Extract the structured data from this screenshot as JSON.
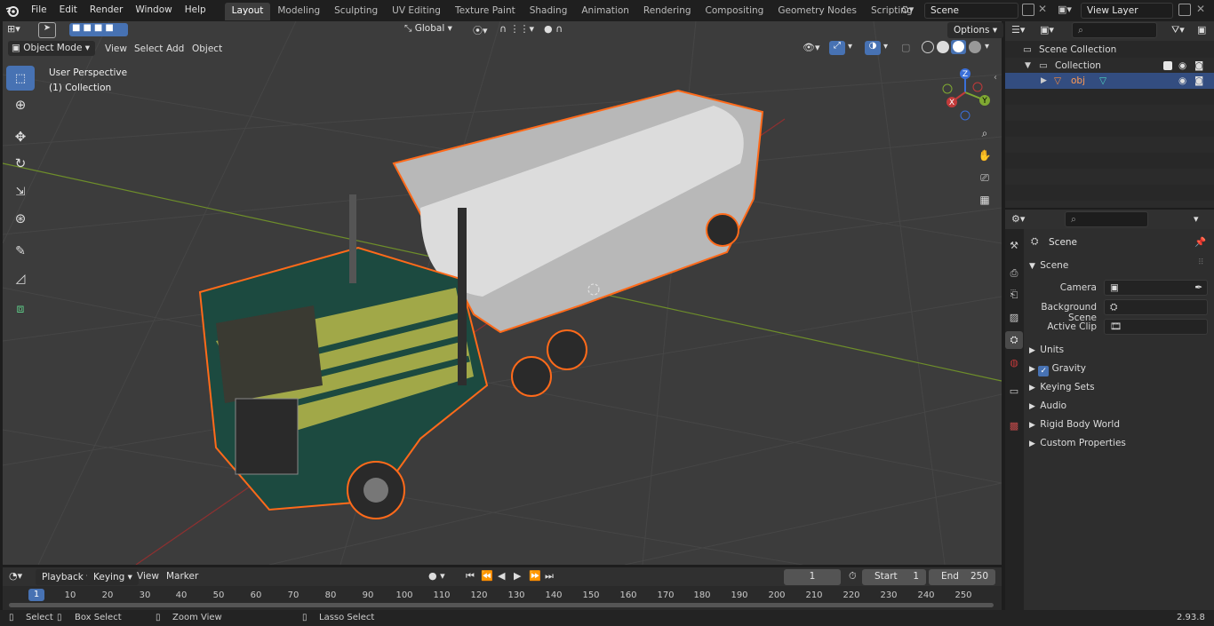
{
  "app": {
    "version": "2.93.8"
  },
  "menu": {
    "file": "File",
    "edit": "Edit",
    "render": "Render",
    "window": "Window",
    "help": "Help"
  },
  "workspaces": [
    "Layout",
    "Modeling",
    "Sculpting",
    "UV Editing",
    "Texture Paint",
    "Shading",
    "Animation",
    "Rendering",
    "Compositing",
    "Geometry Nodes",
    "Scripting"
  ],
  "scene_field": "Scene",
  "view_layer_field": "View Layer",
  "viewport": {
    "orientation": "Global",
    "options_label": "Options",
    "mode": "Object Mode",
    "menus": {
      "view": "View",
      "select": "Select",
      "add": "Add",
      "object": "Object"
    },
    "perspective_label": "User Perspective",
    "collection_label": "(1) Collection",
    "gizmo": {
      "z": "Z",
      "y": "Y",
      "x": "X"
    }
  },
  "outliner": {
    "scene_collection": "Scene Collection",
    "collection": "Collection",
    "object": "obj"
  },
  "properties": {
    "context_title": "Scene",
    "panel_title": "Scene",
    "camera_label": "Camera",
    "background_scene_label": "Background Scene",
    "active_clip_label": "Active Clip",
    "subpanels": {
      "units": "Units",
      "gravity": "Gravity",
      "keying_sets": "Keying Sets",
      "audio": "Audio",
      "rigid_body_world": "Rigid Body World",
      "custom_properties": "Custom Properties"
    },
    "gravity_checked": true
  },
  "timeline": {
    "menus": {
      "playback": "Playback",
      "keying": "Keying",
      "view": "View",
      "marker": "Marker"
    },
    "current_frame": "1",
    "start_label": "Start",
    "start_value": "1",
    "end_label": "End",
    "end_value": "250",
    "ruler": [
      "1",
      "10",
      "20",
      "30",
      "40",
      "50",
      "60",
      "70",
      "80",
      "90",
      "100",
      "110",
      "120",
      "130",
      "140",
      "150",
      "160",
      "170",
      "180",
      "190",
      "200",
      "210",
      "220",
      "230",
      "240",
      "250"
    ]
  },
  "statusbar": {
    "select": "Select",
    "box_select": "Box Select",
    "zoom_view": "Zoom View",
    "lasso_select": "Lasso Select"
  },
  "colors": {
    "accent": "#4772b3",
    "selection_outline": "#ff6a1a",
    "x_axis": "#c23a3a",
    "y_axis": "#7fa832",
    "z_axis": "#3a6fd8",
    "cab_green": "#1c4a40",
    "cab_yellow": "#b8b84a"
  }
}
